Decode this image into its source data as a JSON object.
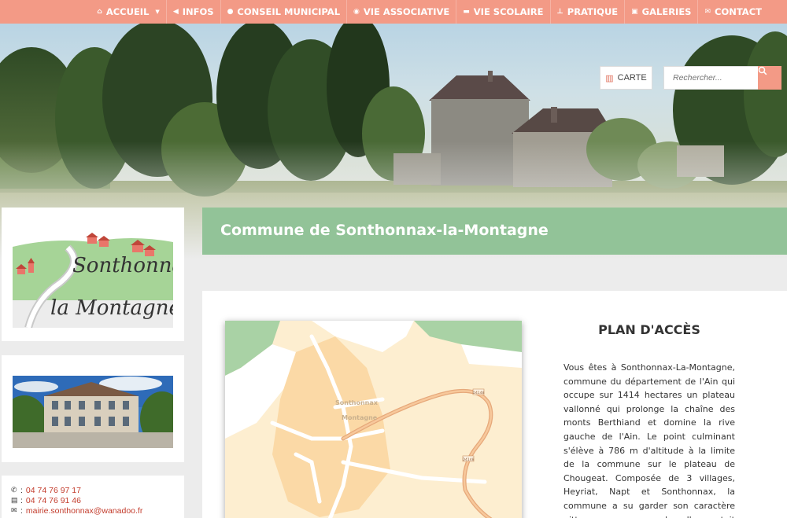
{
  "nav": {
    "items": [
      {
        "label": "ACCUEIL",
        "icon": "home-icon",
        "has_dropdown": true
      },
      {
        "label": "INFOS",
        "icon": "bullhorn-icon"
      },
      {
        "label": "CONSEIL MUNICIPAL",
        "icon": "user-icon"
      },
      {
        "label": "VIE ASSOCIATIVE",
        "icon": "globe-icon"
      },
      {
        "label": "VIE SCOLAIRE",
        "icon": "book-icon"
      },
      {
        "label": "PRATIQUE",
        "icon": "pushpin-icon"
      },
      {
        "label": "GALERIES",
        "icon": "image-icon"
      },
      {
        "label": "CONTACT",
        "icon": "envelope-icon"
      }
    ]
  },
  "header": {
    "carte_label": "CARTE",
    "search_placeholder": "Rechercher..."
  },
  "logo": {
    "line1": "Sonthonnax",
    "line2": "la Montagne"
  },
  "contact": {
    "phone": "04 74 76 97 17",
    "fax": "04 74 76 91 46",
    "email": "mairie.sonthonnax@wanadoo.fr"
  },
  "page_title": "Commune de Sonthonnax-la-Montagne",
  "plan": {
    "title": "PLAN D'ACCÈS",
    "text": "Vous êtes à Sonthonnax-La-Montagne, commune du département de l'Ain qui occupe sur 1414 hectares un plateau vallonné qui prolonge la chaîne des monts Berthiand et domine la rive gauche de l'Ain. Le point culminant s'élève à 786 m d'altitude à la limite de la commune sur le plateau de Chougeat. Composée de 3 villages, Heyriat, Napt et Sonthonnax, la commune a su garder son caractère pittoresque avec ses chapelles en toit de"
  },
  "map": {
    "village_label_1": "Sonthonnax",
    "village_label_2": "Montagne",
    "road_label": "D4148"
  },
  "colors": {
    "nav_bg": "#f39a86",
    "accent_green": "#92c398",
    "link_red": "#c33c2c"
  }
}
